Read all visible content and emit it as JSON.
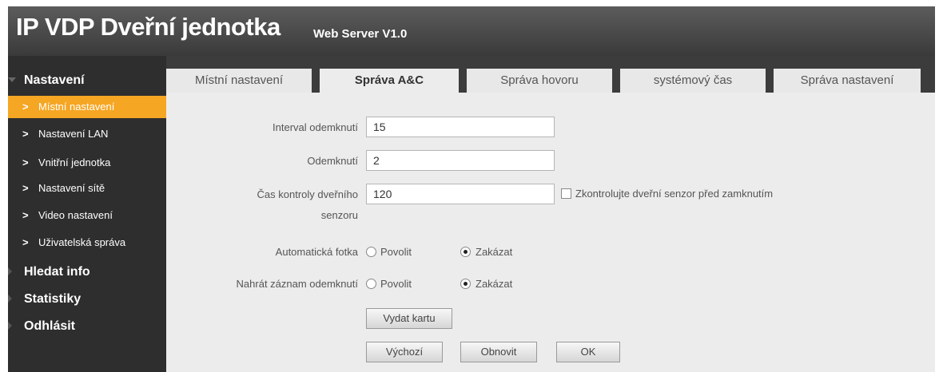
{
  "header": {
    "title": "IP VDP Dveřní jednotka",
    "subtitle": "Web Server V1.0"
  },
  "sidebar": {
    "sections": [
      {
        "label": "Nastavení",
        "expanded": true
      },
      {
        "label": "Hledat info",
        "expanded": false
      },
      {
        "label": "Statistiky",
        "expanded": false
      },
      {
        "label": "Odhlásit",
        "expanded": false
      }
    ],
    "items": [
      {
        "label": "Místní nastavení",
        "active": true
      },
      {
        "label": "Nastavení LAN"
      },
      {
        "label": "Vnitřní jednotka"
      },
      {
        "label": "Nastavení sítě"
      },
      {
        "label": "Video nastavení"
      },
      {
        "label": "Uživatelská správa"
      }
    ],
    "active_color": "#f5a623"
  },
  "tabs": [
    {
      "label": "Místní nastavení"
    },
    {
      "label": "Správa A&C",
      "active": true
    },
    {
      "label": "Správa hovoru"
    },
    {
      "label": "systémový čas"
    },
    {
      "label": "Správa nastavení"
    }
  ],
  "form": {
    "unlock_interval": {
      "label": "Interval odemknutí",
      "value": "15"
    },
    "unlock": {
      "label": "Odemknutí",
      "value": "2"
    },
    "door_sensor_time": {
      "label_line1": "Čas kontroly dveřního",
      "label_line2": "senzoru",
      "value": "120"
    },
    "check_sensor": {
      "label": "Zkontrolujte dveřní senzor před zamknutím",
      "checked": false
    },
    "auto_snapshot": {
      "label": "Automatická fotka",
      "option_enable": "Povolit",
      "option_disable": "Zakázat",
      "selected": "Zakázat"
    },
    "unlock_record": {
      "label": "Nahrát záznam odemknutí",
      "option_enable": "Povolit",
      "option_disable": "Zakázat",
      "selected": "Zakázat"
    },
    "issue_card_button": "Vydat kartu",
    "default_button": "Výchozí",
    "refresh_button": "Obnovit",
    "ok_button": "OK"
  }
}
